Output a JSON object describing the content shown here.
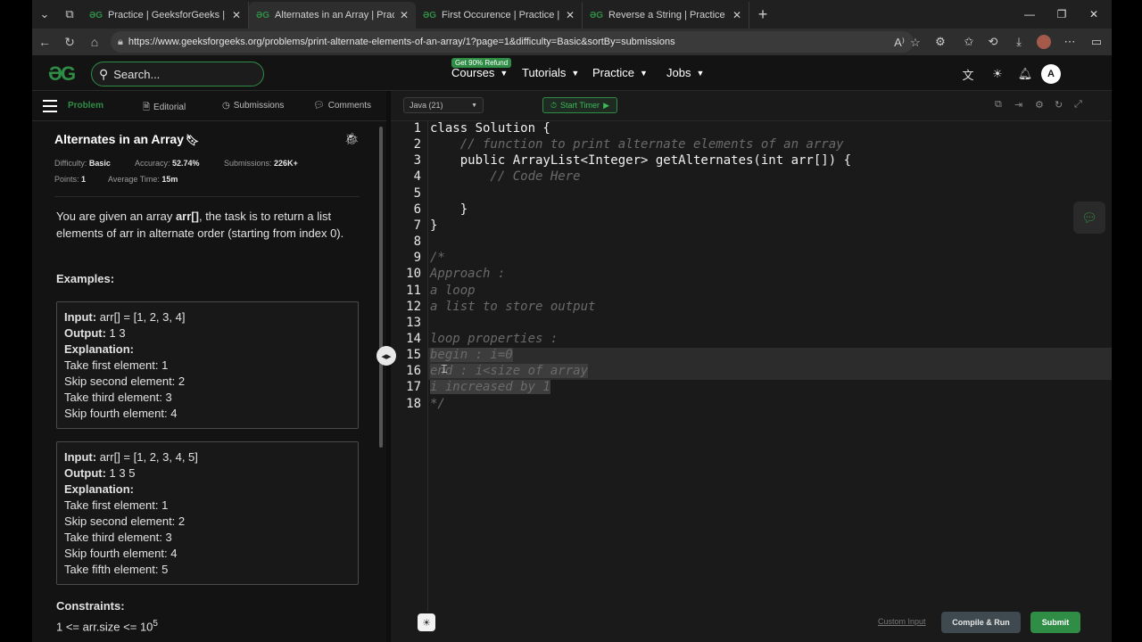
{
  "browser": {
    "tabs": [
      {
        "title": "Practice | GeeksforGeeks | A comp",
        "active": false
      },
      {
        "title": "Alternates in an Array | Practice | G",
        "active": true
      },
      {
        "title": "First Occurence | Practice | Geeksfor",
        "active": false
      },
      {
        "title": "Reverse a String | Practice | Geeksfo",
        "active": false
      }
    ],
    "favicon_text": "ƏG",
    "url": "https://www.geeksforgeeks.org/problems/print-alternate-elements-of-an-array/1?page=1&difficulty=Basic&sortBy=submissions"
  },
  "header": {
    "logo": "ƏG",
    "search_placeholder": "Search...",
    "promo": "Get 90% Refund",
    "menus": [
      "Courses",
      "Tutorials",
      "Practice",
      "Jobs"
    ],
    "avatar": "A"
  },
  "left_tabs": [
    "Problem",
    "Editorial",
    "Submissions",
    "Comments"
  ],
  "problem": {
    "title": "Alternates in an Array",
    "difficulty_label": "Difficulty:",
    "difficulty": "Basic",
    "accuracy_label": "Accuracy:",
    "accuracy": "52.74%",
    "submissions_label": "Submissions:",
    "submissions": "226K+",
    "points_label": "Points:",
    "points": "1",
    "avgtime_label": "Average Time:",
    "avgtime": "15m",
    "desc_pre": "You are given an array ",
    "desc_arr": "arr[]",
    "desc_post": ", the task is to return a list elements of arr in alternate order (starting from index 0).",
    "examples_label": "Examples:",
    "example1": {
      "input_label": "Input:",
      "input": " arr[] = [1, 2, 3, 4]",
      "output_label": "Output:",
      "output": " 1 3",
      "expl_label": "Explanation:",
      "lines": [
        "Take first element: 1",
        "Skip second element: 2",
        "Take third element: 3",
        "Skip fourth element: 4"
      ]
    },
    "example2": {
      "input_label": "Input:",
      "input": " arr[] = [1, 2, 3, 4, 5]",
      "output_label": "Output:",
      "output": " 1 3 5",
      "expl_label": "Explanation:",
      "lines": [
        "Take first element: 1",
        "Skip second element: 2",
        "Take third element: 3",
        "Skip fourth element: 4",
        "Take fifth element: 5"
      ]
    },
    "constraints_label": "Constraints:",
    "constraint_base": "1 <=  arr.size <= 10",
    "constraint_exp": "5"
  },
  "editor": {
    "language": "Java (21)",
    "timer": "Start Timer",
    "lines": [
      "class Solution {",
      "    // function to print alternate elements of an array",
      "    public ArrayList<Integer> getAlternates(int arr[]) {",
      "        // Code Here",
      "",
      "    }",
      "}",
      "",
      "/*",
      "Approach :",
      "a loop",
      "a list to store output",
      "",
      "loop properties :",
      "begin : i=0",
      "end : i<size of array",
      "i increased by 1",
      "*/"
    ],
    "custom_input": "Custom Input",
    "compile_run": "Compile & Run",
    "submit": "Submit"
  }
}
